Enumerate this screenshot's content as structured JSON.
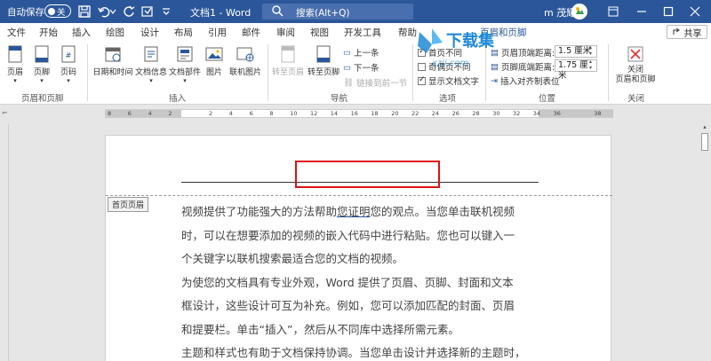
{
  "titlebar": {
    "autosave_label": "自动保存",
    "autosave_state": "关",
    "doc_title": "文档1 - Word",
    "search_placeholder": "搜索(Alt+Q)",
    "user_name": "m 茂耀"
  },
  "tabs": [
    {
      "label": "文件",
      "active": false
    },
    {
      "label": "开始",
      "active": false
    },
    {
      "label": "插入",
      "active": false
    },
    {
      "label": "绘图",
      "active": false
    },
    {
      "label": "设计",
      "active": false
    },
    {
      "label": "布局",
      "active": false
    },
    {
      "label": "引用",
      "active": false
    },
    {
      "label": "邮件",
      "active": false
    },
    {
      "label": "审阅",
      "active": false
    },
    {
      "label": "视图",
      "active": false
    },
    {
      "label": "开发工具",
      "active": false
    },
    {
      "label": "帮助",
      "active": false
    },
    {
      "label": "页眉和页脚",
      "active": true
    }
  ],
  "share_label": "共享",
  "ribbon": {
    "group1": {
      "label": "页眉和页脚",
      "header": "页眉",
      "footer": "页脚",
      "page_number": "页码"
    },
    "group2": {
      "label": "插入",
      "datetime": "日期和时间",
      "docinfo": "文档信息",
      "docparts": "文档部件",
      "picture": "图片",
      "onlinepic": "联机图片"
    },
    "group3": {
      "label": "导航",
      "goto_header": "转至页眉",
      "goto_footer": "转至页脚",
      "prev": "上一条",
      "next": "下一条",
      "link_prev": "链接到前一节"
    },
    "group4": {
      "label": "选项",
      "first_page_diff": "首页不同",
      "odd_even_diff": "奇偶页不同",
      "show_doc_text": "显示文档文字"
    },
    "group5": {
      "label": "位置",
      "header_top_label": "页眉顶端距离:",
      "header_top_value": "1.5 厘米",
      "footer_bottom_label": "页脚底端距离:",
      "footer_bottom_value": "1.75 厘米",
      "insert_align_tab": "插入对齐制表位"
    },
    "group6": {
      "label": "关闭",
      "close_btn": "关闭\n页眉和页脚"
    }
  },
  "watermark": {
    "text": "下载集",
    "sub": "xzji.com"
  },
  "ruler_numbers": [
    "8",
    "6",
    "4",
    "2",
    "",
    "2",
    "4",
    "6",
    "8",
    "10",
    "12",
    "14",
    "16",
    "18",
    "20",
    "22",
    "24",
    "26",
    "28",
    "30",
    "32",
    "34",
    "36",
    "",
    "38"
  ],
  "page": {
    "header_tag": "首页页眉",
    "lines": [
      [
        "视频提供了功能强大的方法帮助",
        "您证明",
        "您的观点。当您单击联机视频"
      ],
      [
        "时，可以在想要添加的视频的嵌入代码中进行粘贴。您也可以键入一"
      ],
      [
        "个关键字以联机搜索最适合您的文档的视频。"
      ],
      [
        "为使您的文档具有专业外观，Word 提供了页眉、页脚、封面和文本"
      ],
      [
        "框设计，这些设计可互为补充。例如，您可以添加匹配的封面、页眉"
      ],
      [
        "和提要栏。单击“插入”，然后从不同库中选择所需元素。"
      ],
      [
        "主题和样式也有助于文档保持协调。当您单击设计并选择新的主题时，"
      ]
    ]
  }
}
